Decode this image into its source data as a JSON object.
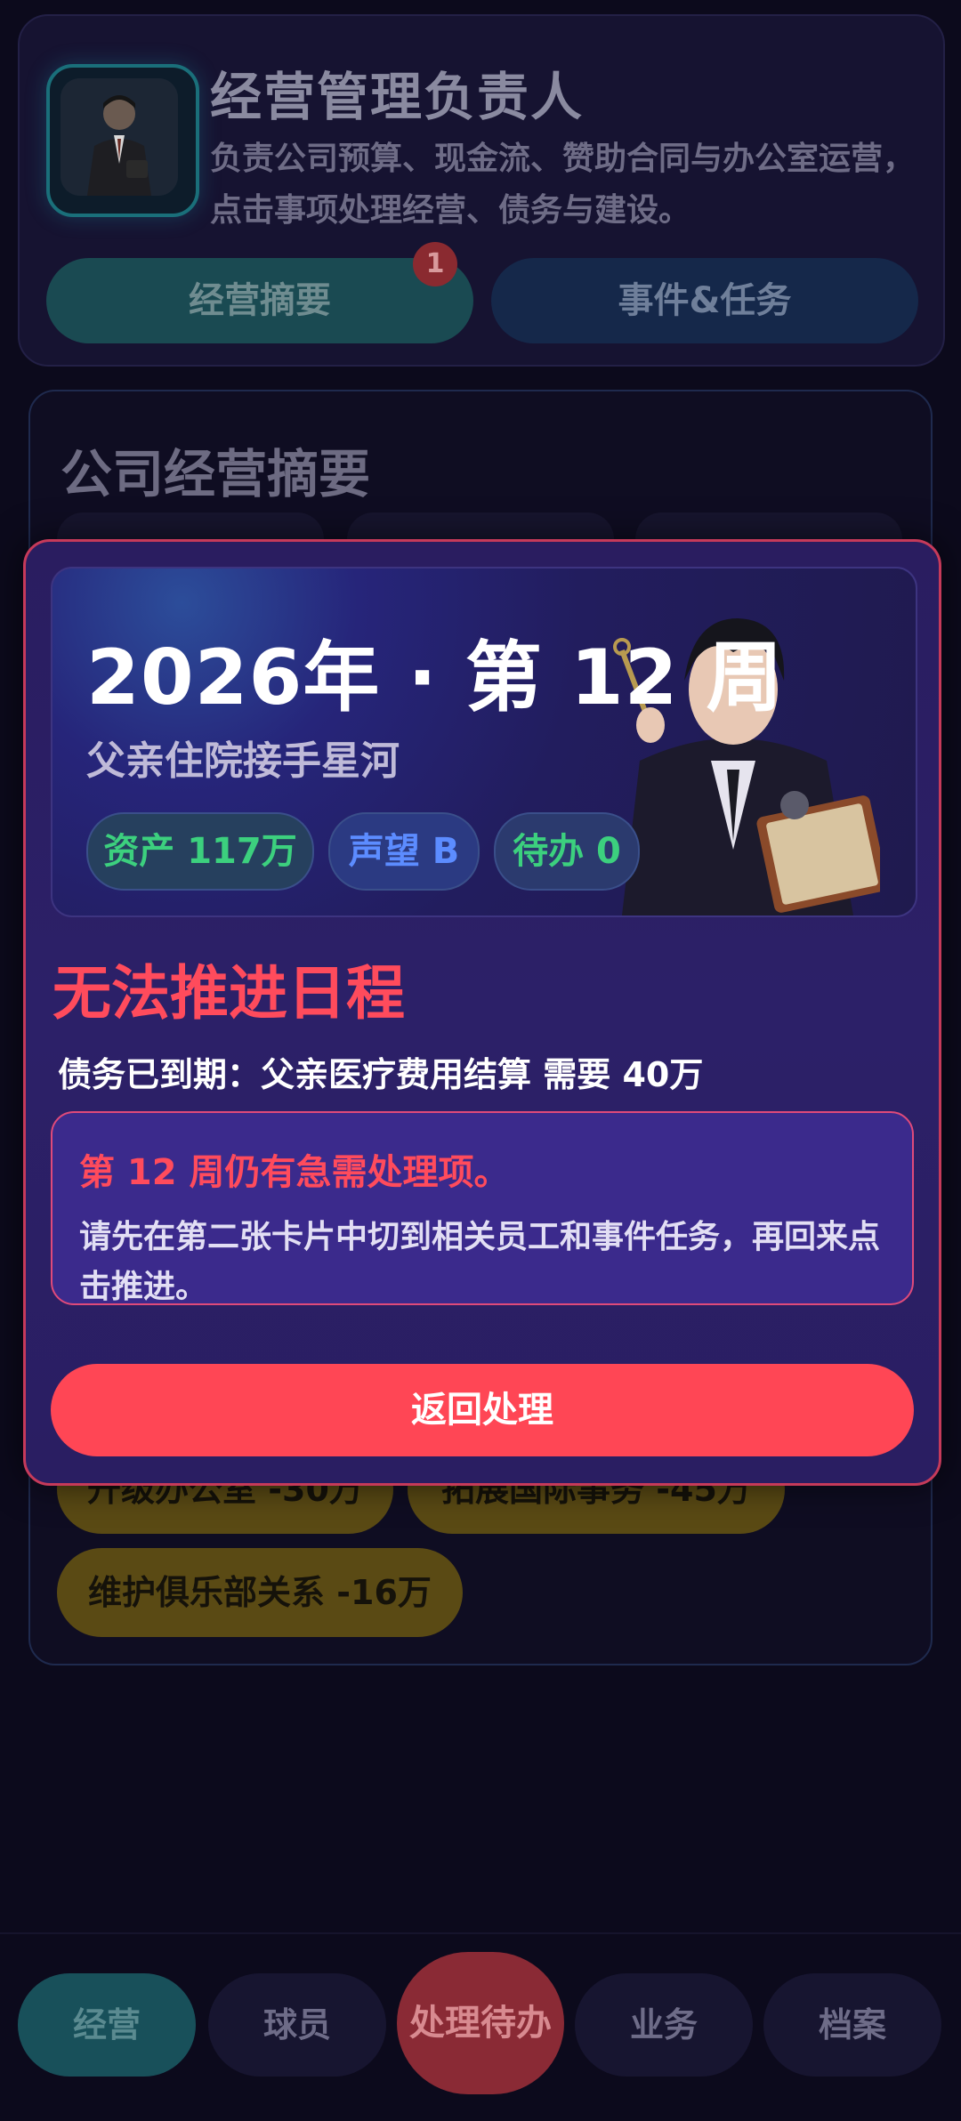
{
  "header": {
    "role_title": "经营管理负责人",
    "role_desc": "负责公司预算、现金流、赞助合同与办公室运营，点击事项处理经营、债务与建设。",
    "tab_summary": "经营摘要",
    "tab_events": "事件&任务",
    "badge_count": "1"
  },
  "summary": {
    "title": "公司经营摘要",
    "pills": [
      "升级办公室 -30万",
      "拓展国际事务 -45万",
      "维护俱乐部关系 -16万"
    ]
  },
  "modal": {
    "week_title": "2026年 · 第 12 周",
    "subtitle": "父亲住院接手星河",
    "chips": [
      "资产 117万",
      "声望 B",
      "待办 0"
    ],
    "fail_title": "无法推进日程",
    "debt_line": "债务已到期：父亲医疗费用结算 需要 40万",
    "alert_title": "第 12 周仍有急需处理项。",
    "alert_body": "请先在第二张卡片中切到相关员工和事件任务，再回来点击推进。",
    "back_button": "返回处理"
  },
  "nav": {
    "items": [
      "经营",
      "球员",
      "处理待办",
      "业务",
      "档案"
    ]
  },
  "colors": {
    "accent_red": "#ff4655",
    "accent_green": "#3cd07e",
    "accent_blue": "#5c8cff",
    "modal_bg": "#2c2068"
  }
}
